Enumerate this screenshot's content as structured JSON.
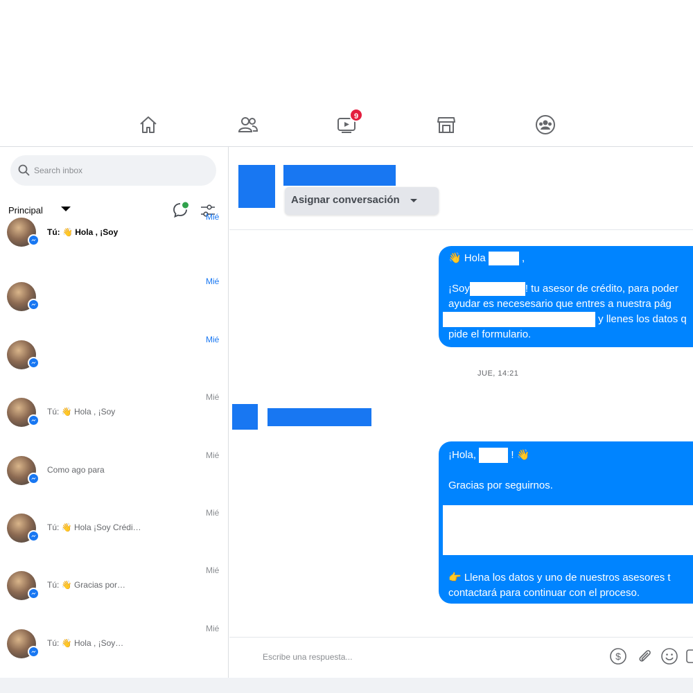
{
  "nav": {
    "items": [
      {
        "name": "home",
        "icon": "home-icon"
      },
      {
        "name": "friends",
        "icon": "friends-icon"
      },
      {
        "name": "watch",
        "icon": "video-icon",
        "badge": "9"
      },
      {
        "name": "marketplace",
        "icon": "store-icon"
      },
      {
        "name": "groups",
        "icon": "groups-icon"
      }
    ]
  },
  "sidebar": {
    "search_placeholder": "Search inbox",
    "filter_label": "Principal",
    "conversations": [
      {
        "preview": "Tú: 👋 Hola        , ¡Soy",
        "date": "Mié",
        "bold": true,
        "date_color": "#1877f2"
      },
      {
        "preview": "",
        "date": "Mié",
        "bold": false,
        "date_color": "#1877f2"
      },
      {
        "preview": "",
        "date": "Mié",
        "bold": false,
        "date_color": "#1877f2"
      },
      {
        "preview": "Tú: 👋 Hola             , ¡Soy",
        "date": "Mié",
        "bold": false,
        "date_color": "#8a8d91"
      },
      {
        "preview": "Como ago para",
        "date": "Mié",
        "bold": false,
        "date_color": "#8a8d91"
      },
      {
        "preview": "Tú: 👋 Hola                    ¡Soy Crédi…",
        "date": "Mié",
        "bold": false,
        "date_color": "#8a8d91"
      },
      {
        "preview": "Tú:                      👋 Gracias por…",
        "date": "Mié",
        "bold": false,
        "date_color": "#8a8d91"
      },
      {
        "preview": "Tú: 👋 Hola                       , ¡Soy…",
        "date": "Mié",
        "bold": false,
        "date_color": "#8a8d91"
      }
    ]
  },
  "header": {
    "assign_label": "Asignar conversación"
  },
  "messages": {
    "m1": {
      "line1a": "👋 Hola",
      "line1b": ",",
      "line2a": "¡Soy",
      "line2b": "! tu asesor de crédito, para poder",
      "line3": "ayudar es necesesario que entres a nuestra pág",
      "line4b": "y llenes los datos q",
      "line5": "pide el formulario."
    },
    "timestamp": "JUE, 14:21",
    "m2": {
      "line1a": "¡Hola,",
      "line1b": "!  👋",
      "line2": "Gracias por seguirnos.",
      "line3": "👉 Llena los datos y uno de nuestros asesores t",
      "line4": "contactará para continuar con el proceso."
    }
  },
  "composer": {
    "placeholder": "Escribe una respuesta..."
  },
  "colors": {
    "accent": "#1877f2",
    "bubble": "#0084ff",
    "badge": "#e41e3f"
  }
}
